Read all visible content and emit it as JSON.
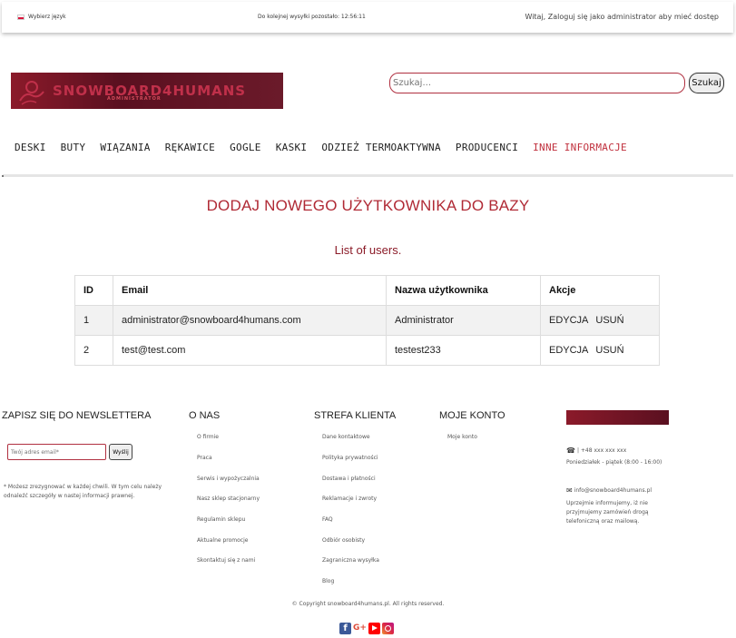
{
  "topbar": {
    "language": "Wybierz język",
    "timer": "Do kolejnej wysyłki pozostało: 12:56:11",
    "welcome": "Witaj, Zaloguj się jako administrator aby mieć dostęp"
  },
  "logo": {
    "title": "SNOWBOARD4HUMANS",
    "subtitle": "ADMINISTRATOR"
  },
  "search": {
    "placeholder": "Szukaj...",
    "button": "Szukaj"
  },
  "nav": [
    "DESKI",
    "BUTY",
    "WIĄZANIA",
    "RĘKAWICE",
    "GOGLE",
    "KASKI",
    "ODZIEŻ TERMOAKTYWNA",
    "PRODUCENCI",
    "INNE INFORMACJE"
  ],
  "nav_active": "INNE INFORMACJE",
  "page_title": "DODAJ NOWEGO UŻYTKOWNIKA DO BAZY",
  "list_title": "List of users.",
  "table": {
    "headers": [
      "ID",
      "Email",
      "Nazwa użytkownika",
      "Akcje"
    ],
    "rows": [
      {
        "id": "1",
        "email": "administrator@snowboard4humans.com",
        "name": "Administrator"
      },
      {
        "id": "2",
        "email": "test@test.com",
        "name": "testest233"
      }
    ],
    "edit": "EDYCJA",
    "delete": "USUŃ"
  },
  "footer": {
    "newsletter": {
      "title": "ZAPISZ SIĘ DO NEWSLETTERA",
      "placeholder": "Twój adres email*",
      "button": "Wyślij",
      "note": "* Możesz zrezygnować w każdej chwili. W tym celu należy odnaleźć szczegóły w nastej informacji prawnej."
    },
    "about": {
      "title": "O NAS",
      "links": [
        "O firmie",
        "Praca",
        "Serwis i wypożyczalnia",
        "Nasz sklep stacjonarny",
        "Regulamin sklepu",
        "Aktualne promocje",
        "Skontaktuj się z nami"
      ]
    },
    "client": {
      "title": "STREFA KLIENTA",
      "links": [
        "Dane kontaktowe",
        "Polityka prywatności",
        "Dostawa i płatności",
        "Reklamacje i zwroty",
        "FAQ",
        "Odbiór osobisty",
        "Zagraniczna wysyłka",
        "Blog"
      ]
    },
    "account": {
      "title": "MOJE KONTO",
      "links": [
        "Moje konto"
      ]
    },
    "contact": {
      "phone": "| +48 xxx xxx xxx",
      "hours": "Poniedziałek - piątek (8:00 - 16:00)",
      "email": "info@snowboard4humans.pl",
      "note": "Uprzejmie informujemy, iż nie przyjmujemy zamówień drogą telefoniczną oraz mailową."
    },
    "copyright": "© Copyright snowboard4humans.pl. All rights reserved."
  },
  "colors": {
    "accent": "#b02a35",
    "facebook": "#3b5998",
    "google": "#dd4b39",
    "youtube": "#ff0000",
    "instagram": "#e1306c"
  }
}
